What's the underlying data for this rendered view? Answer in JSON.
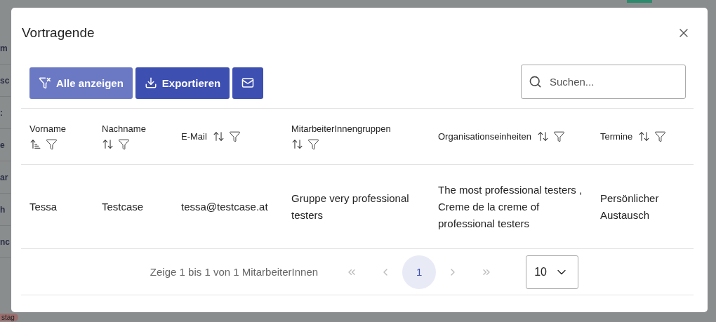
{
  "background": {
    "fragments": [
      {
        "text": "m",
        "kind": "row"
      },
      {
        "text": "sc",
        "kind": "row"
      },
      {
        "text": ":",
        "kind": "row"
      },
      {
        "text": "e",
        "kind": "row"
      },
      {
        "text": "ar",
        "kind": "row"
      },
      {
        "text": "h",
        "kind": "row"
      },
      {
        "text": "nc",
        "kind": "row"
      },
      {
        "text": "stag",
        "kind": "tag"
      }
    ]
  },
  "dialog": {
    "title": "Vortragende"
  },
  "toolbar": {
    "buttons": [
      {
        "kind": "filter",
        "label": "Alle anzeigen",
        "disabled": true
      },
      {
        "kind": "export",
        "label": "Exportieren",
        "disabled": false
      },
      {
        "kind": "mail",
        "disabled": false
      }
    ],
    "search": {
      "placeholder": "Suchen..."
    }
  },
  "table": {
    "columns": [
      {
        "label": "Vorname",
        "sorted": true
      },
      {
        "label": "Nachname",
        "sorted": false
      },
      {
        "label": "E-Mail",
        "sorted": false
      },
      {
        "label": "MitarbeiterInnengruppen",
        "sorted": false
      },
      {
        "label": "Organisationseinheiten",
        "sorted": false
      },
      {
        "label": "Termine",
        "sorted": false
      }
    ],
    "rows": [
      {
        "cells": [
          [
            "Tessa"
          ],
          [
            "Testcase"
          ],
          [
            "tessa@testcase.at"
          ],
          [
            "Gruppe very professional testers"
          ],
          [
            "The most professional testers ,",
            "Creme de la creme of professional testers"
          ],
          [
            "Persönlicher Austausch"
          ]
        ]
      }
    ]
  },
  "pagination": {
    "summary": "Zeige 1 bis 1 von 1 MitarbeiterInnen",
    "pages": [
      {
        "label": "1",
        "selected": true
      }
    ],
    "page_size": "10"
  }
}
